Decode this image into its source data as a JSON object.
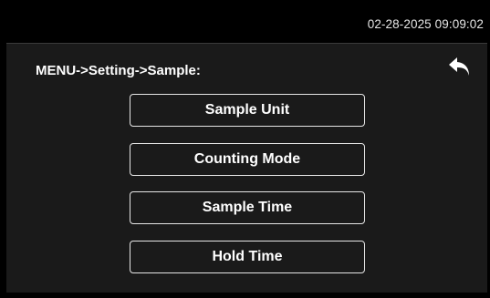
{
  "status_bar": {
    "datetime": "02-28-2025 09:09:02"
  },
  "header": {
    "breadcrumb": "MENU->Setting->Sample:",
    "back_icon": "return-arrow-icon"
  },
  "menu": {
    "items": [
      {
        "label": "Sample Unit"
      },
      {
        "label": "Counting Mode"
      },
      {
        "label": "Sample Time"
      },
      {
        "label": "Hold Time"
      }
    ]
  },
  "colors": {
    "background": "#1a1a1a",
    "status_bar": "#000000",
    "text": "#ffffff",
    "button_border": "#e6e6e6"
  }
}
